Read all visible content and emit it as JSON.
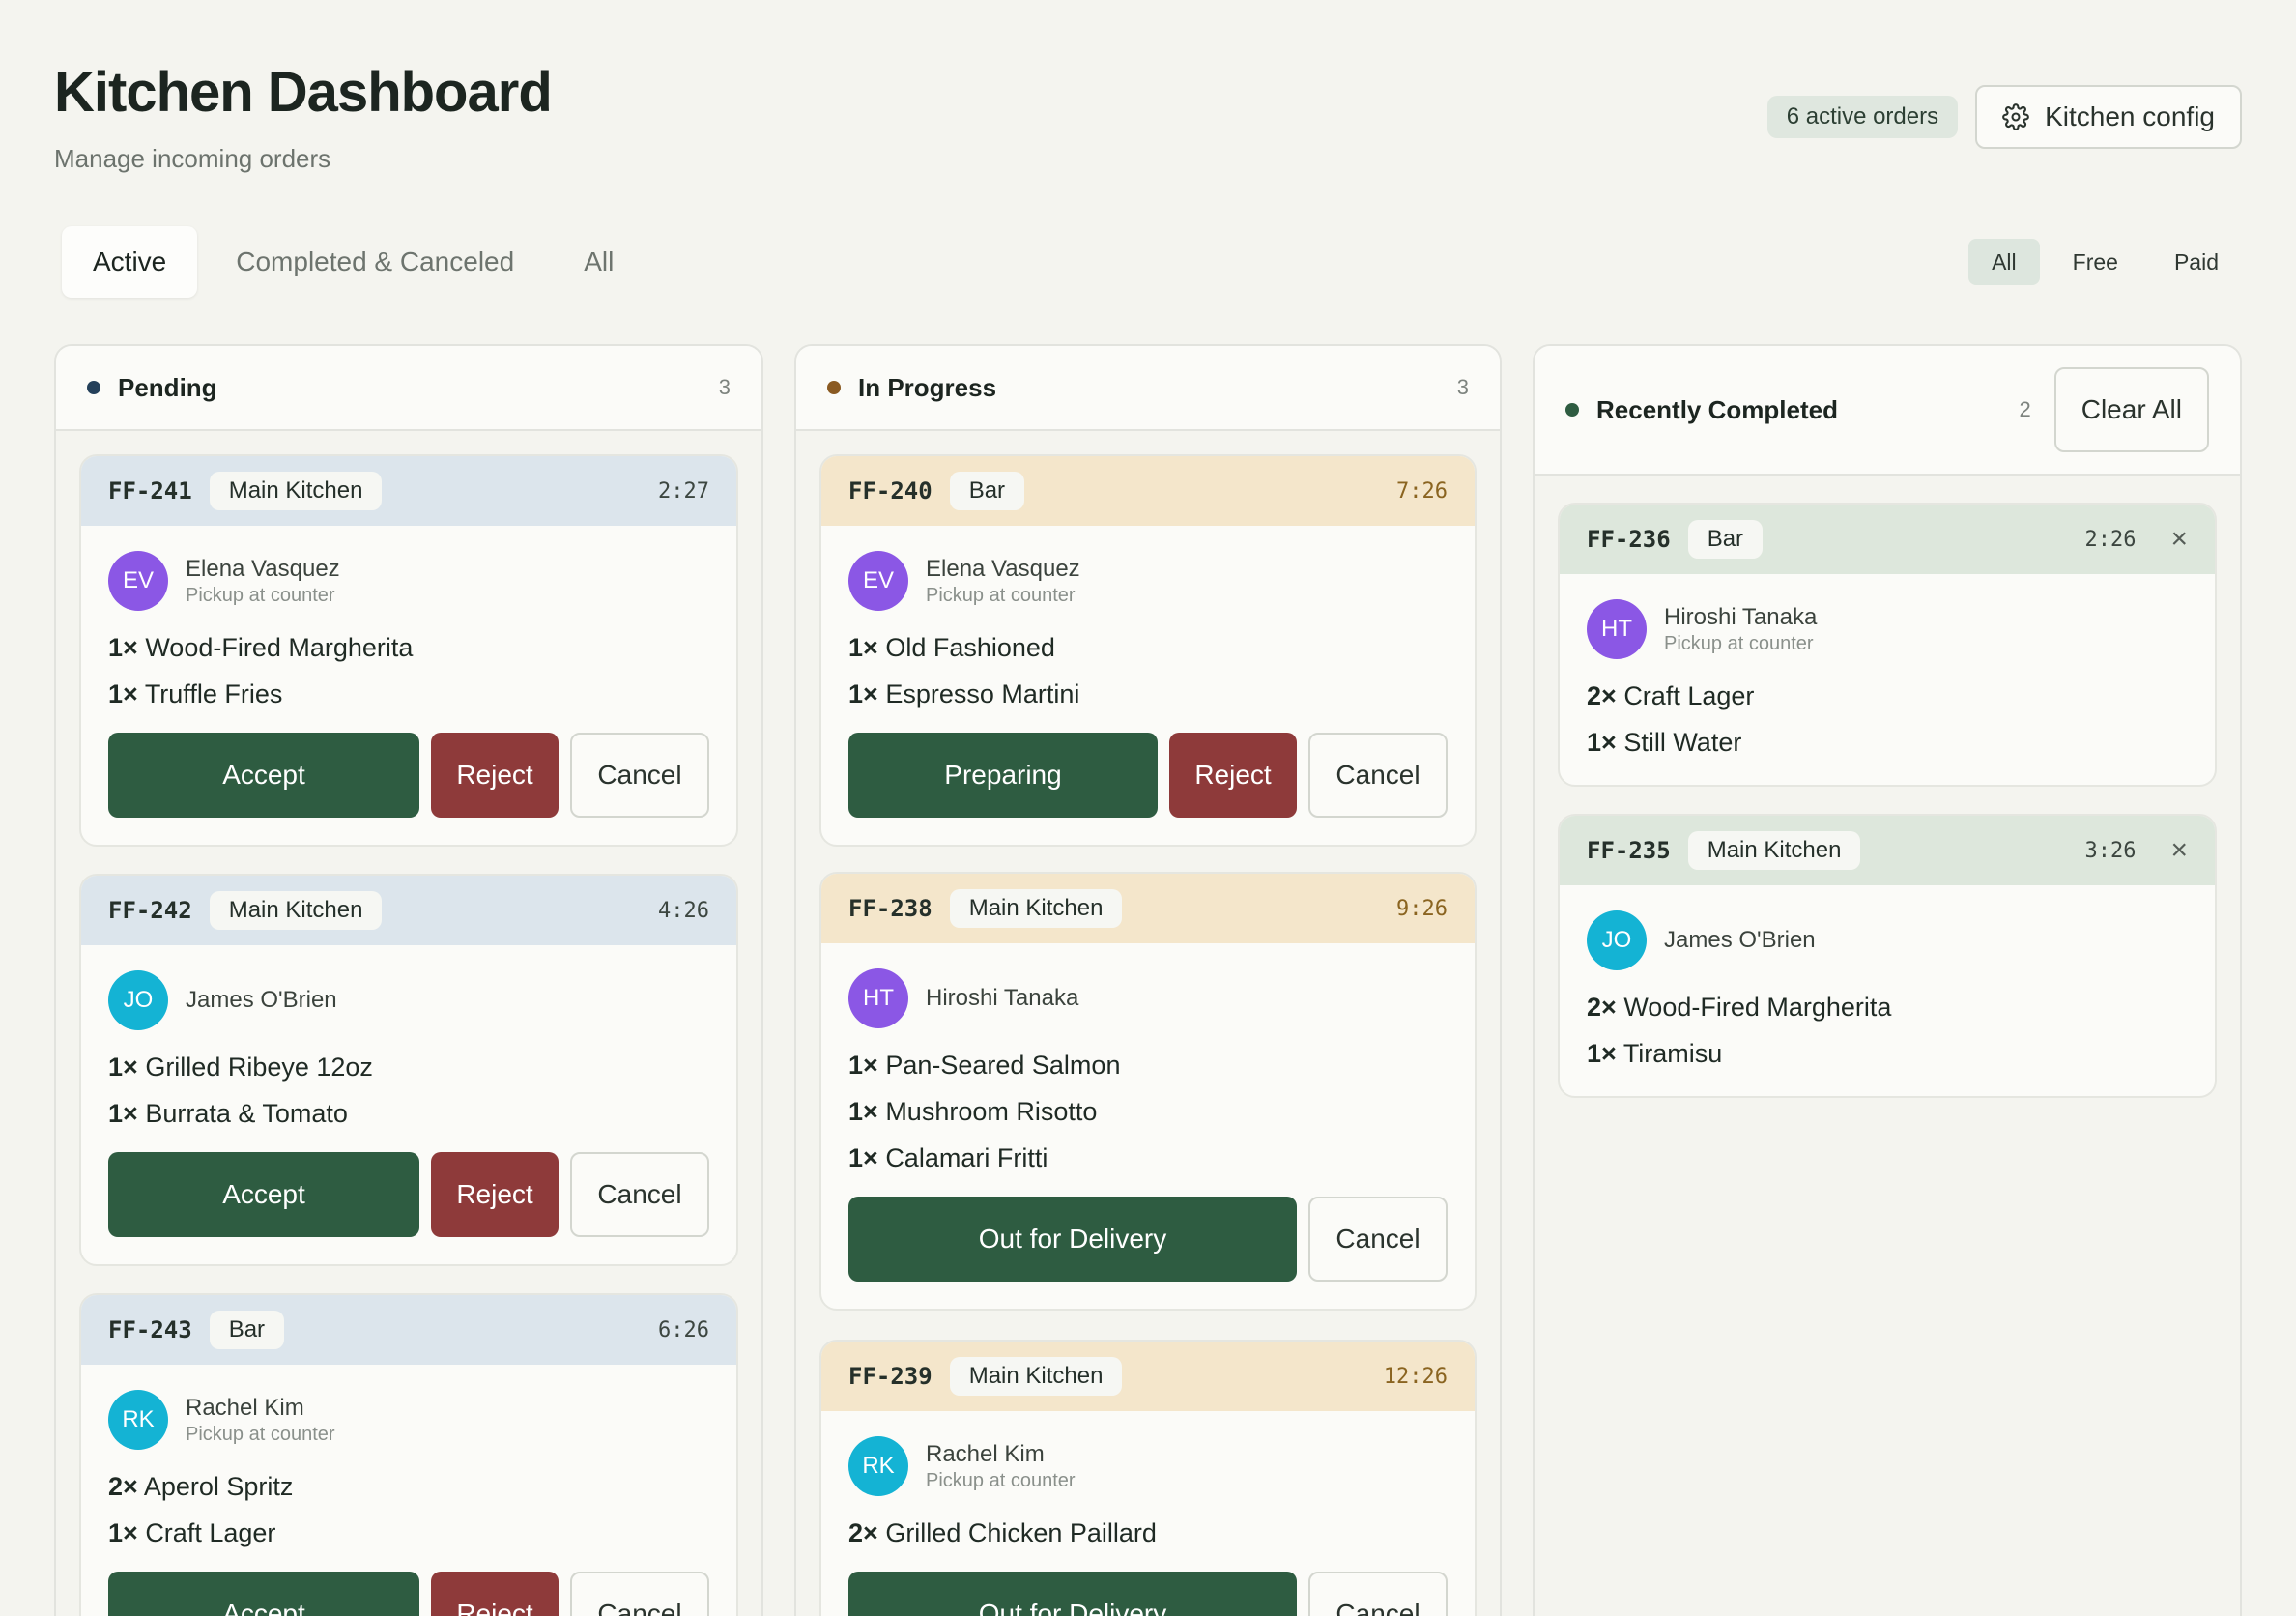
{
  "header": {
    "title": "Kitchen Dashboard",
    "subtitle": "Manage incoming orders",
    "active_orders": "6 active orders",
    "config_label": "Kitchen config"
  },
  "tabs": [
    "Active",
    "Completed & Canceled",
    "All"
  ],
  "filters": [
    "All",
    "Free",
    "Paid"
  ],
  "columns": {
    "pending": {
      "title": "Pending",
      "count": "3",
      "orders": [
        {
          "id": "FF-241",
          "station": "Main Kitchen",
          "time": "2:27",
          "initials": "EV",
          "name": "Elena Vasquez",
          "note": "Pickup at counter",
          "items": [
            {
              "qty": "1×",
              "name": "Wood-Fired Margherita"
            },
            {
              "qty": "1×",
              "name": "Truffle Fries"
            }
          ],
          "primary": "Accept",
          "reject": "Reject",
          "cancel": "Cancel"
        },
        {
          "id": "FF-242",
          "station": "Main Kitchen",
          "time": "4:26",
          "initials": "JO",
          "name": "James O'Brien",
          "items": [
            {
              "qty": "1×",
              "name": "Grilled Ribeye 12oz"
            },
            {
              "qty": "1×",
              "name": "Burrata & Tomato"
            }
          ],
          "primary": "Accept",
          "reject": "Reject",
          "cancel": "Cancel"
        },
        {
          "id": "FF-243",
          "station": "Bar",
          "time": "6:26",
          "initials": "RK",
          "name": "Rachel Kim",
          "note": "Pickup at counter",
          "items": [
            {
              "qty": "2×",
              "name": "Aperol Spritz"
            },
            {
              "qty": "1×",
              "name": "Craft Lager"
            }
          ],
          "primary": "Accept",
          "reject": "Reject",
          "cancel": "Cancel"
        }
      ]
    },
    "progress": {
      "title": "In Progress",
      "count": "3",
      "orders": [
        {
          "id": "FF-240",
          "station": "Bar",
          "time": "7:26",
          "initials": "EV",
          "name": "Elena Vasquez",
          "note": "Pickup at counter",
          "items": [
            {
              "qty": "1×",
              "name": "Old Fashioned"
            },
            {
              "qty": "1×",
              "name": "Espresso Martini"
            }
          ],
          "primary": "Preparing",
          "reject": "Reject",
          "cancel": "Cancel"
        },
        {
          "id": "FF-238",
          "station": "Main Kitchen",
          "time": "9:26",
          "initials": "HT",
          "name": "Hiroshi Tanaka",
          "items": [
            {
              "qty": "1×",
              "name": "Pan-Seared Salmon"
            },
            {
              "qty": "1×",
              "name": "Mushroom Risotto"
            },
            {
              "qty": "1×",
              "name": "Calamari Fritti"
            }
          ],
          "primary": "Out for Delivery",
          "cancel": "Cancel"
        },
        {
          "id": "FF-239",
          "station": "Main Kitchen",
          "time": "12:26",
          "initials": "RK",
          "name": "Rachel Kim",
          "note": "Pickup at counter",
          "items": [
            {
              "qty": "2×",
              "name": "Grilled Chicken Paillard"
            }
          ],
          "primary": "Out for Delivery",
          "cancel": "Cancel"
        }
      ]
    },
    "completed": {
      "title": "Recently Completed",
      "count": "2",
      "clear_label": "Clear All",
      "orders": [
        {
          "id": "FF-236",
          "station": "Bar",
          "time": "2:26",
          "initials": "HT",
          "name": "Hiroshi Tanaka",
          "note": "Pickup at counter",
          "items": [
            {
              "qty": "2×",
              "name": "Craft Lager"
            },
            {
              "qty": "1×",
              "name": "Still Water"
            }
          ]
        },
        {
          "id": "FF-235",
          "station": "Main Kitchen",
          "time": "3:26",
          "initials": "JO",
          "name": "James O'Brien",
          "items": [
            {
              "qty": "2×",
              "name": "Wood-Fired Margherita"
            },
            {
              "qty": "1×",
              "name": "Tiramisu"
            }
          ]
        }
      ]
    }
  },
  "icons": {
    "config": "gear-icon",
    "dismiss": "close-icon"
  },
  "colors": {
    "accent": "#2e5c41",
    "danger": "#8e3a3a",
    "pending_dot": "#24405a",
    "progress_dot": "#8a5a22",
    "completed_dot": "#2e5c41"
  }
}
